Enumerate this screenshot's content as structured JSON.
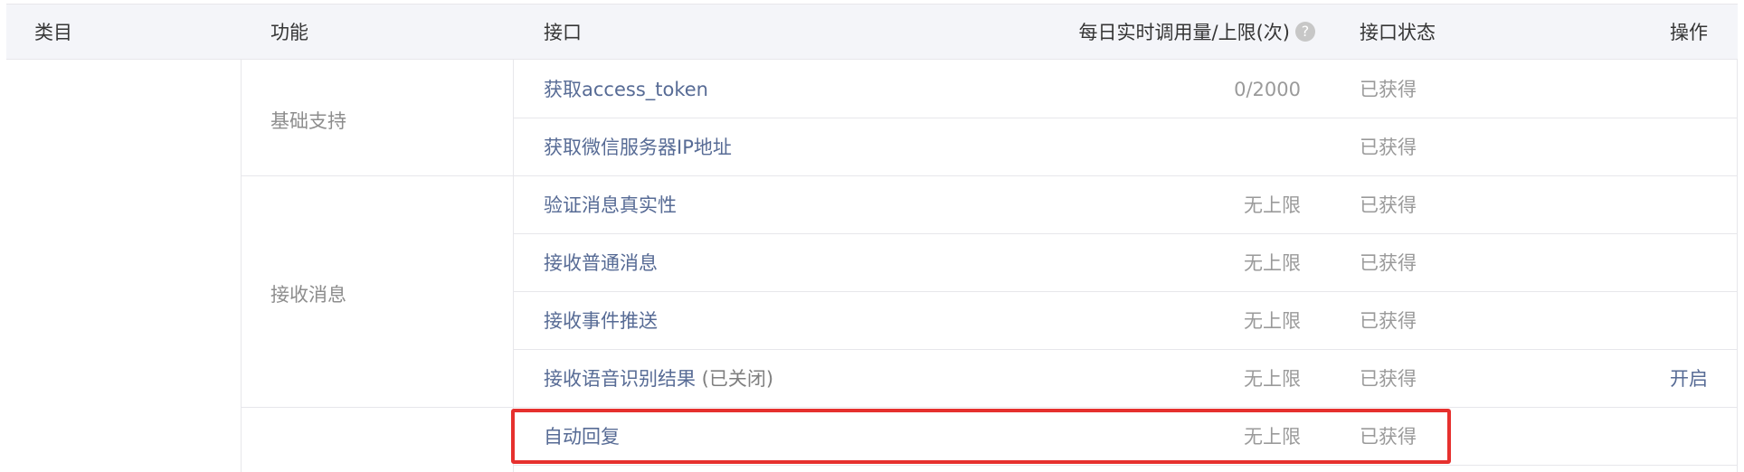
{
  "header": {
    "category": "类目",
    "function": "功能",
    "interface": "接口",
    "quota": "每日实时调用量/上限(次)",
    "help_icon": "?",
    "status": "接口状态",
    "action": "操作"
  },
  "groups": [
    {
      "function": "基础支持"
    },
    {
      "function": "接收消息"
    }
  ],
  "rows": [
    {
      "interface": "获取access_token",
      "suffix": "",
      "quota": "0/2000",
      "status": "已获得",
      "action": ""
    },
    {
      "interface": "获取微信服务器IP地址",
      "suffix": "",
      "quota": "",
      "status": "已获得",
      "action": ""
    },
    {
      "interface": "验证消息真实性",
      "suffix": "",
      "quota": "无上限",
      "status": "已获得",
      "action": ""
    },
    {
      "interface": "接收普通消息",
      "suffix": "",
      "quota": "无上限",
      "status": "已获得",
      "action": ""
    },
    {
      "interface": "接收事件推送",
      "suffix": "",
      "quota": "无上限",
      "status": "已获得",
      "action": ""
    },
    {
      "interface": "接收语音识别结果",
      "suffix": " (已关闭)",
      "quota": "无上限",
      "status": "已获得",
      "action": "开启"
    },
    {
      "interface": "自动回复",
      "suffix": "",
      "quota": "无上限",
      "status": "已获得",
      "action": ""
    }
  ],
  "colors": {
    "link": "#576b95",
    "muted": "#9a9a9a",
    "header_bg": "#f4f5f9",
    "border": "#e7e7eb",
    "highlight": "#e6302e"
  }
}
